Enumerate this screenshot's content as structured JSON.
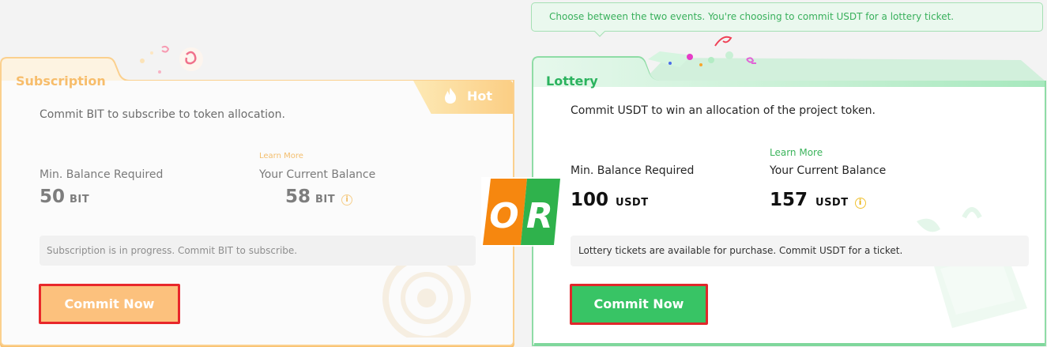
{
  "tooltip": {
    "text": "Choose between the two events. You're choosing to commit USDT for a lottery ticket."
  },
  "subscription": {
    "title": "Subscription",
    "badge": "Hot",
    "description": "Commit BIT to subscribe to token allocation.",
    "learn_more": "Learn More",
    "min_balance_label": "Min. Balance Required",
    "min_balance_value": "50",
    "min_balance_unit": "BIT",
    "current_balance_label": "Your Current Balance",
    "current_balance_value": "58",
    "current_balance_unit": "BIT",
    "info_glyph": "i",
    "notice": "Subscription is in progress. Commit BIT to subscribe.",
    "commit_label": "Commit Now",
    "accent_color": "#fcc17d"
  },
  "or_badge": {
    "left": "O",
    "right": "R",
    "left_color": "#f6870f",
    "right_color": "#2fb24c"
  },
  "lottery": {
    "title": "Lottery",
    "description": "Commit USDT to win an allocation of the project token.",
    "learn_more": "Learn More",
    "min_balance_label": "Min. Balance Required",
    "min_balance_value": "100",
    "min_balance_unit": "USDT",
    "current_balance_label": "Your Current Balance",
    "current_balance_value": "157",
    "current_balance_unit": "USDT",
    "info_glyph": "i",
    "notice": "Lottery tickets are available for purchase. Commit USDT for a ticket.",
    "commit_label": "Commit Now",
    "accent_color": "#38c465"
  },
  "highlight_color": "#e0272b"
}
